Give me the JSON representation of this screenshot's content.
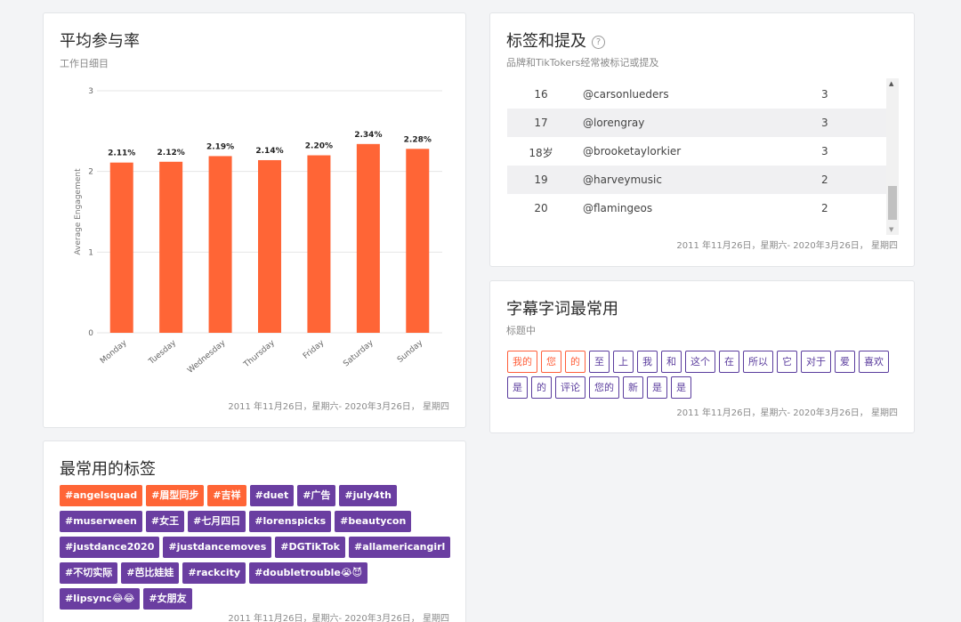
{
  "engagement": {
    "title": "平均参与率",
    "subtitle": "工作日细目",
    "date_range": "2011 年11月26日，星期六- 2020年3月26日，  星期四"
  },
  "chart_data": {
    "type": "bar",
    "categories": [
      "Monday",
      "Tuesday",
      "Wednesday",
      "Thursday",
      "Friday",
      "Saturday",
      "Sunday"
    ],
    "values": [
      2.11,
      2.12,
      2.19,
      2.14,
      2.2,
      2.34,
      2.28
    ],
    "data_labels": [
      "2.11%",
      "2.12%",
      "2.19%",
      "2.14%",
      "2.20%",
      "2.34%",
      "2.28%"
    ],
    "ylabel": "Average Engagement",
    "ylim": [
      0,
      3
    ],
    "yticks": [
      "0",
      "1",
      "2",
      "3"
    ],
    "grid": true,
    "bar_color": "#ff6536"
  },
  "mentions": {
    "title": "标签和提及",
    "help_icon": "?",
    "subtitle": "品牌和TikTokers经常被标记或提及",
    "rows": [
      {
        "rank": "16",
        "name": "@carsonlueders",
        "count": "3"
      },
      {
        "rank": "17",
        "name": "@lorengray",
        "count": "3"
      },
      {
        "rank": "18岁",
        "name": "@brooketaylorkier",
        "count": "3"
      },
      {
        "rank": "19",
        "name": "@harveymusic",
        "count": "2"
      },
      {
        "rank": "20",
        "name": "@flamingeos",
        "count": "2"
      }
    ],
    "date_range": "2011 年11月26日，星期六- 2020年3月26日，  星期四"
  },
  "words": {
    "title": "字幕字词最常用",
    "subtitle": "标题中",
    "items": [
      {
        "text": "我的",
        "hot": true
      },
      {
        "text": "您",
        "hot": true
      },
      {
        "text": "的",
        "hot": true
      },
      {
        "text": "至",
        "hot": false
      },
      {
        "text": "上",
        "hot": false
      },
      {
        "text": "我",
        "hot": false
      },
      {
        "text": "和",
        "hot": false
      },
      {
        "text": "这个",
        "hot": false
      },
      {
        "text": "在",
        "hot": false
      },
      {
        "text": "所以",
        "hot": false
      },
      {
        "text": "它",
        "hot": false
      },
      {
        "text": "对于",
        "hot": false
      },
      {
        "text": "爱",
        "hot": false
      },
      {
        "text": "喜欢",
        "hot": false
      },
      {
        "text": "是",
        "hot": false
      },
      {
        "text": "的",
        "hot": false
      },
      {
        "text": "评论",
        "hot": false
      },
      {
        "text": "您的",
        "hot": false
      },
      {
        "text": "新",
        "hot": false
      },
      {
        "text": "是",
        "hot": false
      },
      {
        "text": "是",
        "hot": false
      }
    ],
    "date_range": "2011 年11月26日，星期六- 2020年3月26日，  星期四"
  },
  "hashtags": {
    "title": "最常用的标签",
    "items": [
      {
        "text": "#angelsquad",
        "hot": true
      },
      {
        "text": "#眉型同步",
        "hot": true
      },
      {
        "text": "#吉祥",
        "hot": true
      },
      {
        "text": "#duet",
        "hot": false
      },
      {
        "text": "#广告",
        "hot": false
      },
      {
        "text": "#july4th",
        "hot": false
      },
      {
        "text": "#muserween",
        "hot": false
      },
      {
        "text": "#女王",
        "hot": false
      },
      {
        "text": "#七月四日",
        "hot": false
      },
      {
        "text": "#lorenspicks",
        "hot": false
      },
      {
        "text": "#beautycon",
        "hot": false
      },
      {
        "text": "#justdance2020",
        "hot": false
      },
      {
        "text": "#justdancemoves",
        "hot": false
      },
      {
        "text": "#DGTikTok",
        "hot": false
      },
      {
        "text": "#allamericangirl",
        "hot": false
      },
      {
        "text": "#不切实际",
        "hot": false
      },
      {
        "text": "#芭比娃娃",
        "hot": false
      },
      {
        "text": "#rackcity",
        "hot": false
      },
      {
        "text": "#doubletrouble😭😈",
        "hot": false
      },
      {
        "text": "#lipsync😂😂",
        "hot": false
      },
      {
        "text": "#女朋友",
        "hot": false
      }
    ],
    "date_range": "2011 年11月26日，星期六- 2020年3月26日，  星期四"
  },
  "colors": {
    "accent_orange": "#ff6536",
    "accent_purple": "#6a3ea1"
  }
}
